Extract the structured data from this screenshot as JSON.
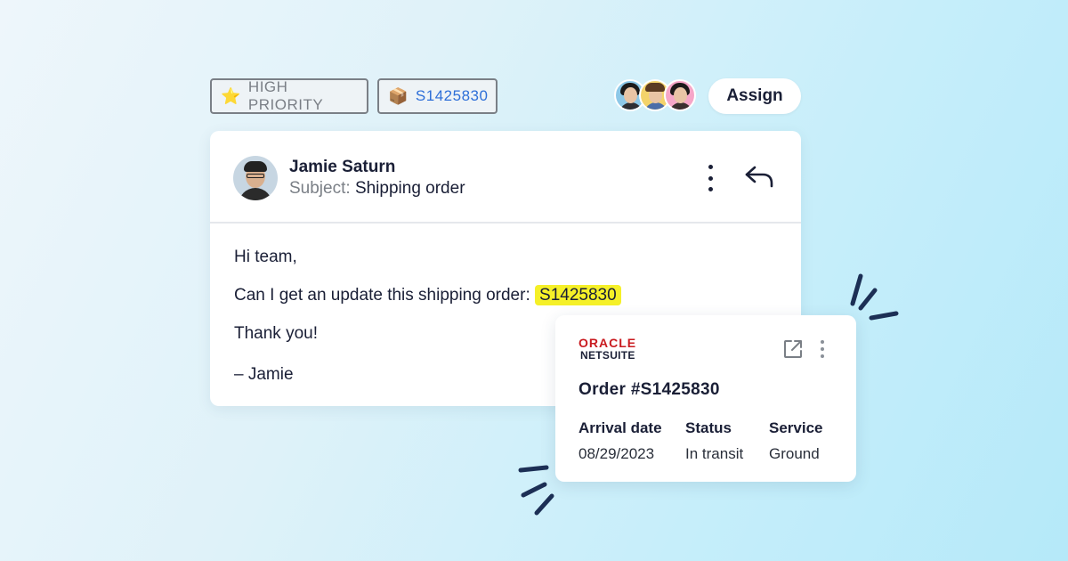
{
  "tags": {
    "priority": {
      "icon": "star-icon",
      "label": "HIGH PRIORITY"
    },
    "order": {
      "icon": "package-icon",
      "label": "S1425830"
    }
  },
  "assignees": [
    "avatar-woman-1",
    "avatar-man",
    "avatar-woman-2"
  ],
  "assign_button": {
    "label": "Assign"
  },
  "email": {
    "sender": "Jamie Saturn",
    "subject_label": "Subject:",
    "subject": "Shipping order",
    "greeting": "Hi team,",
    "request_text": "Can I get an update this shipping order:",
    "order_ref": "S1425830",
    "thanks": "Thank you!",
    "signoff": "– Jamie"
  },
  "netsuite_card": {
    "logo_top": "ORACLE",
    "logo_bottom": "NETSUITE",
    "title": "Order #S1425830",
    "columns": [
      {
        "header": "Arrival date",
        "value": "08/29/2023"
      },
      {
        "header": "Status",
        "value": "In transit"
      },
      {
        "header": "Service",
        "value": "Ground"
      }
    ]
  },
  "colors": {
    "highlight": "#f5f028",
    "oracle_red": "#c91b20",
    "order_tag_blue": "#2e6fd8",
    "accent_strokes": "#1c2f55"
  }
}
